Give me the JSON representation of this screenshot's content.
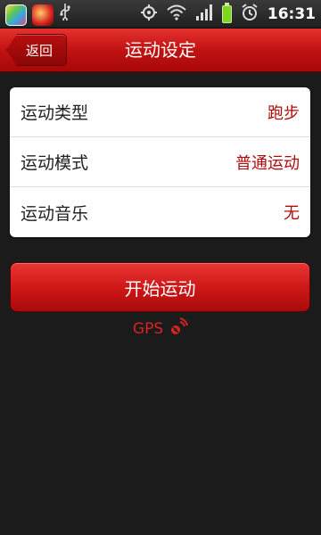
{
  "status_bar": {
    "time": "16:31",
    "icons": [
      "app-grid-icon",
      "app-bird-icon",
      "usb-icon",
      "gps-target-icon",
      "wifi-icon",
      "signal-icon",
      "battery-charging-icon",
      "alarm-icon"
    ]
  },
  "header": {
    "back_label": "返回",
    "title": "运动设定"
  },
  "settings": [
    {
      "label": "运动类型",
      "value": "跑步"
    },
    {
      "label": "运动模式",
      "value": "普通运动"
    },
    {
      "label": "运动音乐",
      "value": "无"
    }
  ],
  "actions": {
    "start_label": "开始运动"
  },
  "gps": {
    "label": "GPS"
  },
  "colors": {
    "accent_red": "#c21212",
    "value_red": "#b10b0b",
    "background": "#1b1b1b"
  }
}
